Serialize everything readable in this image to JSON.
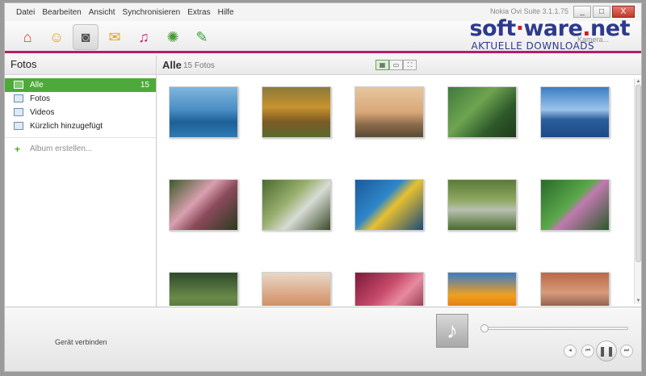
{
  "menu": {
    "items": [
      "Datei",
      "Bearbeiten",
      "Ansicht",
      "Synchronisieren",
      "Extras",
      "Hilfe"
    ],
    "app_version": "Nokia Ovi Suite 3.1.1.75"
  },
  "window_controls": {
    "minimize": "_",
    "maximize": "□",
    "close": "X"
  },
  "toolbar": {
    "icons": [
      {
        "name": "home-icon",
        "glyph": "⌂",
        "color": "#d13b2a"
      },
      {
        "name": "contacts-icon",
        "glyph": "☺",
        "color": "#e8a21c"
      },
      {
        "name": "camera-icon",
        "glyph": "◙",
        "color": "#555555",
        "active": true
      },
      {
        "name": "messages-icon",
        "glyph": "✉",
        "color": "#e8a21c"
      },
      {
        "name": "music-icon",
        "glyph": "♫",
        "color": "#c4287d"
      },
      {
        "name": "maps-icon",
        "glyph": "✺",
        "color": "#4a9a3a"
      },
      {
        "name": "sync-icon",
        "glyph": "✎",
        "color": "#3aa040"
      }
    ]
  },
  "watermark": {
    "main_a": "soft",
    "dot": "·",
    "main_b": "ware",
    "dot2": ".",
    "main_c": "net",
    "sub": "AKTUELLE DOWNLOADS",
    "ghost": "Kamera..."
  },
  "sidebar": {
    "title": "Fotos",
    "items": [
      {
        "label": "Alle",
        "count": "15",
        "selected": true
      },
      {
        "label": "Fotos",
        "count": "",
        "selected": false
      },
      {
        "label": "Videos",
        "count": "",
        "selected": false
      },
      {
        "label": "Kürzlich hinzugefügt",
        "count": "",
        "selected": false
      }
    ],
    "create_album": "Album erstellen...",
    "create_glyph": "+"
  },
  "main": {
    "title": "Alle",
    "count": "15 Fotos",
    "view_buttons": [
      "▦",
      "▭",
      "⛶"
    ],
    "photos": [
      {
        "name": "photo-whale",
        "fill": "linear-gradient(#7fb6dd 0%,#4a8ec5 45%,#1d5f98 70%,#2f7ab2 100%)"
      },
      {
        "name": "photo-autumn-tree",
        "fill": "linear-gradient(#8a7a3a 0%,#c8922e 40%,#7a5a24 70%,#5a6a2e 100%)"
      },
      {
        "name": "photo-sunset-trees",
        "fill": "linear-gradient(#e6c6a0 0%,#d9a878 50%,#8a6a4a 75%,#5a4a36 100%)"
      },
      {
        "name": "photo-toucan",
        "fill": "linear-gradient(135deg,#3f7a3c 0%,#6ea450 40%,#2e5a2a 70%,#1e3a1a 100%)"
      },
      {
        "name": "photo-blue-lake",
        "fill": "linear-gradient(#3a7dc4 0%,#9cc4ea 45%,#2a5e9c 65%,#1c4a86 100%)"
      },
      {
        "name": "photo-pink-flowers",
        "fill": "linear-gradient(135deg,#3c5a2a 0%,#d9a0b0 40%,#8a4a5a 60%,#2a3a1e 100%)"
      },
      {
        "name": "photo-waterfall",
        "fill": "linear-gradient(135deg,#4a6a2e 0%,#9ab070 40%,#d8dcd4 60%,#3a4a2a 100%)"
      },
      {
        "name": "photo-sea-turtle",
        "fill": "linear-gradient(135deg,#1a5a9a 0%,#2e86c8 40%,#e8c030 55%,#1a4a7a 100%)"
      },
      {
        "name": "photo-stream",
        "fill": "linear-gradient(#5a7a3a 0%,#8ea860 40%,#b8c0b0 60%,#4a6a2a 100%)"
      },
      {
        "name": "photo-green-leaves",
        "fill": "linear-gradient(135deg,#2a6a2a 0%,#5aa84a 45%,#c07ab0 55%,#2a5a2a 100%)"
      },
      {
        "name": "photo-forest",
        "fill": "linear-gradient(#2e4a2a 0%,#6a8a4a 50%,#3a5a2a 100%)"
      },
      {
        "name": "photo-desert",
        "fill": "linear-gradient(#e8d8c8 0%,#d8a07a 50%,#b8784a 100%)"
      },
      {
        "name": "photo-red-flowers",
        "fill": "linear-gradient(135deg,#7a1a3a 0%,#c84a6a 40%,#e88aa0 60%,#6a1a2a 100%)"
      },
      {
        "name": "photo-orange-flowers",
        "fill": "linear-gradient(#3a7ac8 0%,#f0a020 45%,#e07a10 70%,#3a5a2a 100%)"
      },
      {
        "name": "photo-sunset-rocks",
        "fill": "linear-gradient(#b86a4a 0%,#d89a7a 40%,#8a5a4a 70%,#5a3a2a 100%)"
      }
    ]
  },
  "player": {
    "device_status": "Gerät verbinden",
    "music_glyph": "♪",
    "volume_glyph": "◂",
    "prev_glyph": "⏮",
    "play_glyph": "❚❚",
    "next_glyph": "⏭",
    "progress": 0.0
  }
}
